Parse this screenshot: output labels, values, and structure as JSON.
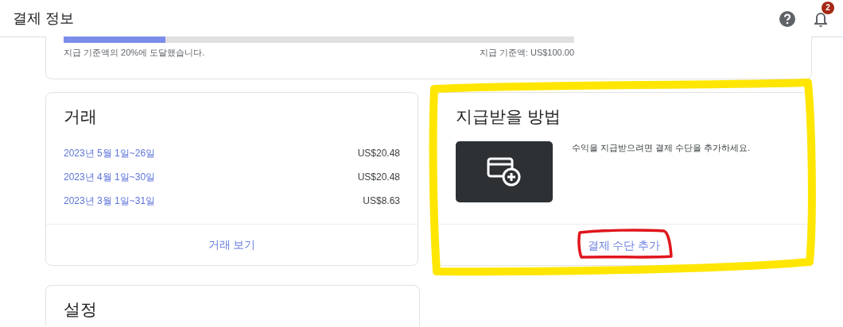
{
  "header": {
    "title": "결제 정보",
    "notification_count": "2"
  },
  "threshold": {
    "level": 0.2,
    "progress_text": "지급 기준액의 20%에 도달했습니다.",
    "threshold_text": "지급 기준액: US$100.00"
  },
  "transactions": {
    "title": "거래",
    "rows": [
      {
        "period": "2023년 5월 1일~26일",
        "amount": "US$20.48"
      },
      {
        "period": "2023년 4월 1일~30일",
        "amount": "US$20.48"
      },
      {
        "period": "2023년 3월 1일~31일",
        "amount": "US$8.63"
      }
    ],
    "action": "거래 보기"
  },
  "payment_method": {
    "title": "지급받을 방법",
    "message": "수익을 지급받으려면 결제 수단을 추가하세요.",
    "action": "결제 수단 추가"
  },
  "settings": {
    "title": "설정"
  },
  "annotations": [
    {
      "kind": "highlight",
      "color": "#ffe600"
    },
    {
      "kind": "circle",
      "color": "#e0161c"
    }
  ]
}
